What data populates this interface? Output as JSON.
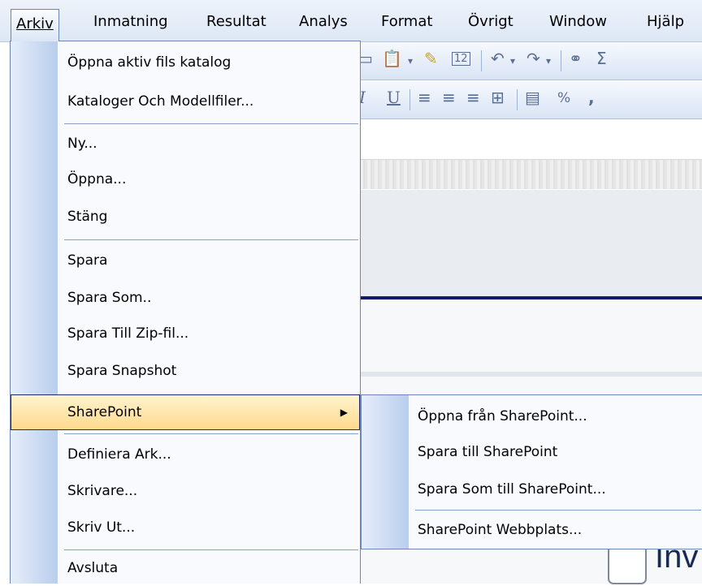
{
  "menubar": {
    "items": [
      {
        "label": "Arkiv"
      },
      {
        "label": "Inmatning"
      },
      {
        "label": "Resultat"
      },
      {
        "label": "Analys"
      },
      {
        "label": "Format"
      },
      {
        "label": "Övrigt"
      },
      {
        "label": "Window"
      },
      {
        "label": "Hjälp"
      }
    ]
  },
  "menu": {
    "items": [
      {
        "label": "Öppna aktiv fils katalog"
      },
      {
        "label": "Kataloger Och Modellfiler..."
      },
      {
        "label": "Ny..."
      },
      {
        "label": "Öppna..."
      },
      {
        "label": "Stäng"
      },
      {
        "label": "Spara"
      },
      {
        "label": "Spara Som.."
      },
      {
        "label": "Spara Till Zip-fil..."
      },
      {
        "label": "Spara Snapshot"
      },
      {
        "label": "SharePoint"
      },
      {
        "label": "Definiera Ark..."
      },
      {
        "label": "Skrivare..."
      },
      {
        "label": "Skriv Ut..."
      },
      {
        "label": "Avsluta"
      }
    ]
  },
  "submenu": {
    "items": [
      {
        "label": "Öppna från SharePoint..."
      },
      {
        "label": "Spara till SharePoint"
      },
      {
        "label": "Spara Som till SharePoint..."
      },
      {
        "label": "SharePoint Webbplats..."
      }
    ]
  },
  "background": {
    "percent_label": "%",
    "font_size_label": "12",
    "document_text": "Inv"
  }
}
